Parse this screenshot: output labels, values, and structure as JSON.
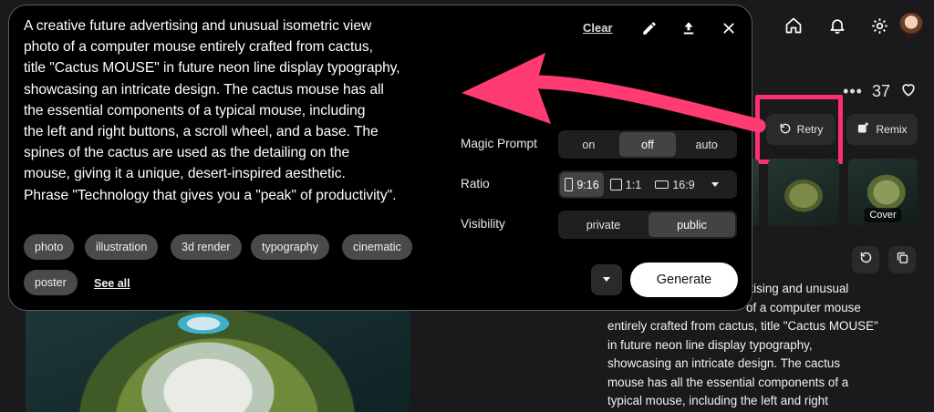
{
  "prompt": {
    "lines": [
      "A creative future advertising and unusual isometric view",
      "photo of a computer mouse entirely crafted from cactus,",
      "title \"Cactus MOUSE\" in future neon line display typography,",
      "showcasing an intricate design. The cactus mouse has all",
      "the essential components of a typical mouse, including",
      "the left and right buttons, a scroll wheel, and a base. The",
      "spines of the cactus are used as the detailing on the",
      "mouse, giving it a unique, desert-inspired aesthetic.",
      "Phrase \"Technology that gives you a \"peak\" of productivity\"."
    ],
    "clear_label": "Clear"
  },
  "options": {
    "magic_prompt": {
      "label": "Magic Prompt",
      "choices": [
        "on",
        "off",
        "auto"
      ],
      "selected": "off"
    },
    "ratio": {
      "label": "Ratio",
      "choices": [
        "9:16",
        "1:1",
        "16:9"
      ],
      "selected": "9:16"
    },
    "visibility": {
      "label": "Visibility",
      "choices": [
        "private",
        "public"
      ],
      "selected": "public"
    }
  },
  "tags": [
    "photo",
    "illustration",
    "3d render",
    "typography",
    "cinematic",
    "poster"
  ],
  "see_all_label": "See all",
  "generate_label": "Generate",
  "detail": {
    "like_count": "37",
    "dots": "•••",
    "retry_label": "Retry",
    "remix_label": "Remix",
    "cover_label": "Cover",
    "description_lines": [
      "rtising and unusual",
      "of a computer mouse",
      "entirely crafted from cactus, title \"Cactus MOUSE\"",
      "in future neon line display typography,",
      "showcasing an intricate design. The cactus",
      "mouse has all the essential components of a",
      "typical mouse, including the left and right"
    ]
  },
  "colors": {
    "highlight": "#ff2e6e",
    "arrow": "#ff3b73",
    "panel_bg": "#000000",
    "app_bg": "#1a1a1c"
  },
  "icons": {
    "nav": [
      "home-icon",
      "bell-icon",
      "gear-icon"
    ],
    "panel": [
      "pencil-icon",
      "upload-icon",
      "close-icon"
    ]
  }
}
